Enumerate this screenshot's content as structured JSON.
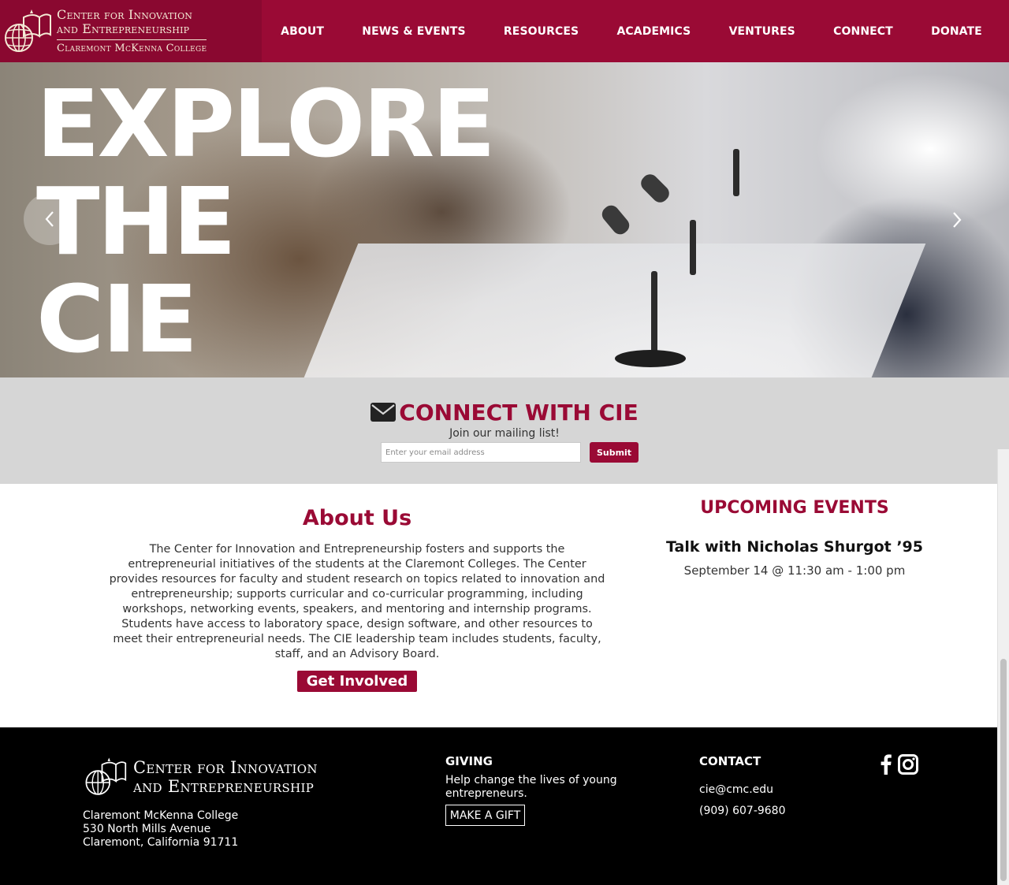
{
  "brand": {
    "line1": "Center for Innovation",
    "line2": "and Entrepreneurship",
    "line3": "Claremont McKenna College",
    "color": "#9a0a35"
  },
  "nav": {
    "items": [
      "ABOUT",
      "NEWS & EVENTS",
      "RESOURCES",
      "ACADEMICS",
      "VENTURES",
      "CONNECT",
      "DONATE"
    ]
  },
  "hero": {
    "title_lines": [
      "EXPLORE",
      "THE",
      "CIE"
    ],
    "prev_icon": "chevron-left-icon",
    "next_icon": "chevron-right-icon"
  },
  "connect": {
    "title": "CONNECT WITH CIE",
    "icon": "envelope-icon",
    "subtitle": "Join our mailing list!",
    "email_placeholder": "Enter your email address",
    "submit_label": "Submit"
  },
  "about": {
    "title": "About Us",
    "body": "The Center for Innovation and Entrepreneurship fosters and supports the entrepreneurial initiatives of the students at the Claremont Colleges. The Center provides resources for faculty and student research on topics related to innovation and entrepreneurship; supports curricular and co-curricular programming, including workshops, networking events, speakers, and mentoring and internship programs. Students have access to laboratory space, design software, and other resources to meet their entrepreneurial needs. The CIE leadership team includes students, faculty, staff, and an Advisory Board.",
    "button_label": "Get Involved"
  },
  "events": {
    "title": "UPCOMING EVENTS",
    "items": [
      {
        "name": "Talk with Nicholas Shurgot ’95",
        "date": "September 14 @ 11:30 am - 1:00 pm"
      }
    ]
  },
  "footer": {
    "logo_line1": "Center for Innovation",
    "logo_line2": "and Entrepreneurship",
    "address_lines": [
      "Claremont McKenna College",
      "530 North Mills Avenue",
      "Claremont, California 91711"
    ],
    "giving_heading": "GIVING",
    "giving_text": "Help change the lives of young entrepreneurs.",
    "gift_button": "MAKE A GIFT",
    "contact_heading": "CONTACT",
    "email": "cie@cmc.edu",
    "phone": "(909) 607-9680",
    "social_icons": [
      "facebook-icon",
      "instagram-icon"
    ]
  }
}
